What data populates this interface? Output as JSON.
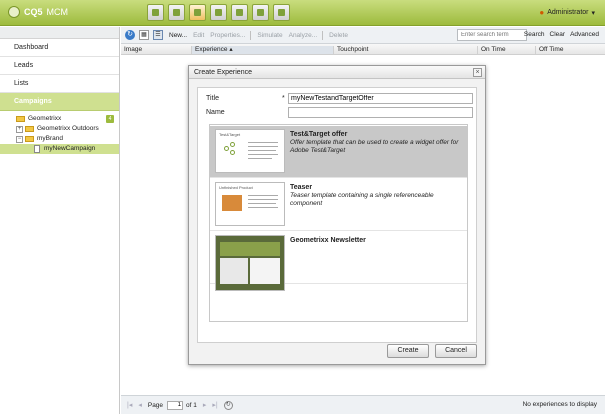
{
  "app": {
    "logo_text": "CQ5",
    "logo_suffix": "MCM"
  },
  "topbar": {
    "user": "Administrator"
  },
  "sidebar": {
    "items": [
      {
        "label": "Dashboard"
      },
      {
        "label": "Leads"
      },
      {
        "label": "Lists"
      },
      {
        "label": "Campaigns"
      }
    ],
    "tree": [
      {
        "label": "Geometrixx",
        "badge": "4"
      },
      {
        "label": "Geometrixx Outdoors"
      },
      {
        "label": "myBrand"
      },
      {
        "label": "myNewCampaign"
      }
    ]
  },
  "toolbar": {
    "new_label": "New...",
    "edit_label": "Edit",
    "properties_label": "Properties...",
    "simulate_label": "Simulate",
    "analyze_label": "Analyze...",
    "delete_label": "Delete",
    "search_placeholder": "Enter search term",
    "search_label": "Search",
    "clear_label": "Clear",
    "advanced_label": "Advanced"
  },
  "grid": {
    "columns": [
      "Image",
      "Experience",
      "Touchpoint",
      "On Time",
      "Off Time"
    ]
  },
  "pagination": {
    "page_label": "Page",
    "page_value": "1",
    "of_label": "of 1",
    "status": "No experiences to display"
  },
  "dialog": {
    "title": "Create Experience",
    "title_label": "Title",
    "title_value": "myNewTestandTargetOffer",
    "name_label": "Name",
    "name_value": "",
    "templates": [
      {
        "name": "Test&Target offer",
        "desc": "Offer template that can be used to create a widget offer for Adobe Test&Target",
        "thumb_label": "Test&Target"
      },
      {
        "name": "Teaser",
        "desc": "Teaser template containing a single referenceable component",
        "thumb_label": "Unfinished Product"
      },
      {
        "name": "Geometrixx Newsletter",
        "desc": ""
      }
    ],
    "create_label": "Create",
    "cancel_label": "Cancel"
  }
}
